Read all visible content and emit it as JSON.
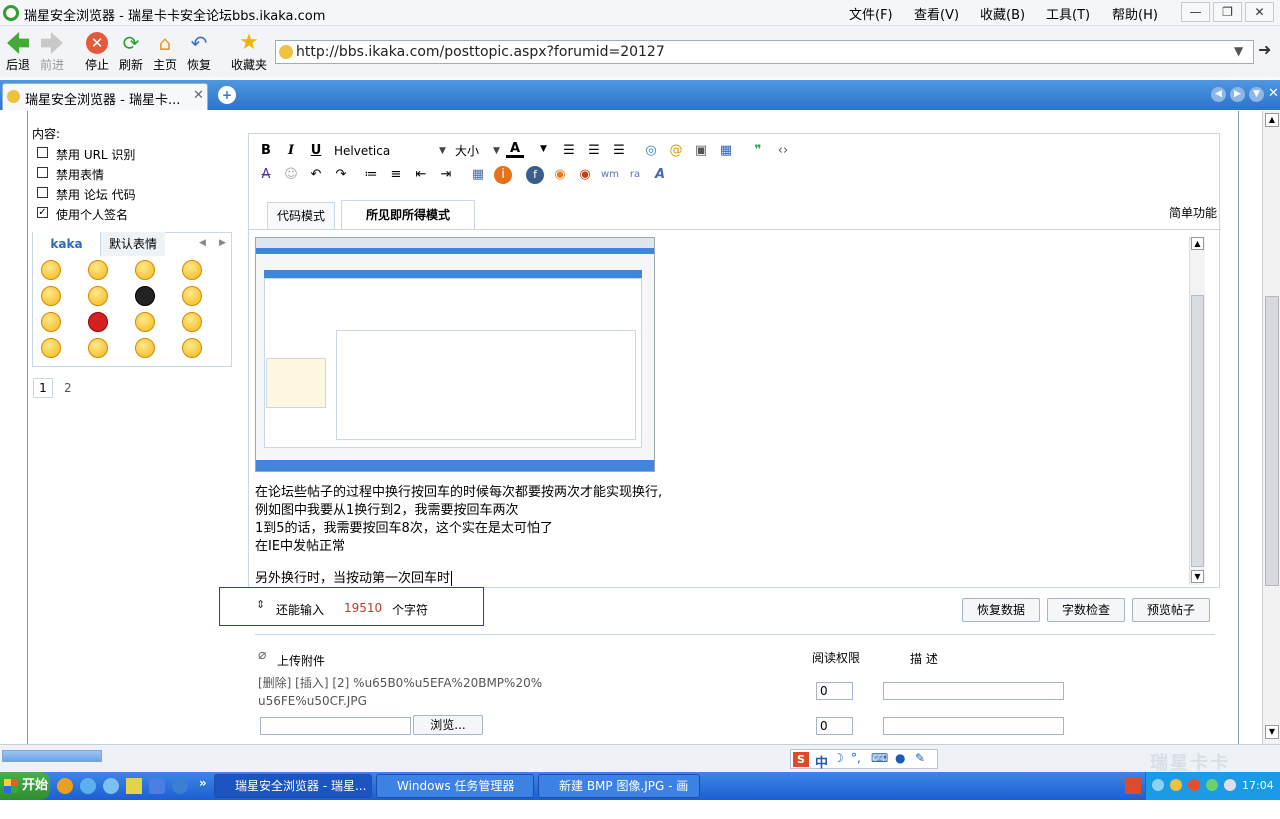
{
  "window": {
    "title": "瑞星安全浏览器 - 瑞星卡卡安全论坛bbs.ikaka.com"
  },
  "menu": {
    "file": "文件(F)",
    "view": "查看(V)",
    "favorites": "收藏(B)",
    "tools": "工具(T)",
    "help": "帮助(H)"
  },
  "toolbar": {
    "back": "后退",
    "forward": "前进",
    "stop": "停止",
    "refresh": "刷新",
    "home": "主页",
    "restore": "恢复",
    "favorites": "收藏夹"
  },
  "address": {
    "url": "http://bbs.ikaka.com/posttopic.aspx?forumid=20127"
  },
  "tabs": [
    {
      "label": "瑞星安全浏览器 - 瑞星卡..."
    }
  ],
  "left": {
    "content_label": "内容:",
    "options": [
      {
        "label": "禁用 URL 识别",
        "checked": false
      },
      {
        "label": "禁用表情",
        "checked": false
      },
      {
        "label": "禁用 论坛 代码",
        "checked": false
      },
      {
        "label": "使用个人签名",
        "checked": true
      }
    ],
    "emoticon_tabs": [
      "kaka",
      "默认表情"
    ],
    "pages": [
      "1",
      "2"
    ]
  },
  "editor": {
    "font_name": "Helvetica",
    "font_size": "大小",
    "mode_tabs": [
      "代码模式",
      "所见即所得模式"
    ],
    "simple_mode": "简单功能",
    "lines": [
      "在论坛些帖子的过程中换行按回车的时候每次都要按两次才能实现换行,",
      "例如图中我要从1换行到2，我需要按回车两次",
      "1到5的话，我需要按回车8次，这个实在是太可怕了",
      "在IE中发帖正常",
      "",
      "另外换行时，当按动第一次回车时"
    ]
  },
  "counter": {
    "prefix": "还能输入",
    "remaining": "19510",
    "suffix": "个字符"
  },
  "buttons": {
    "restore_data": "恢复数据",
    "check_count": "字数检查",
    "preview": "预览帖子"
  },
  "upload": {
    "title": "上传附件",
    "col_permission": "阅读权限",
    "col_description": "描 述",
    "file_line1": "[删除] [插入] [2] %u65B0%u5EFA%20BMP%20%",
    "file_line2": "u56FE%u50CF.JPG",
    "permission1": "0",
    "permission2": "0",
    "browse": "浏览..."
  },
  "taskbar": {
    "start": "开始",
    "tasks": [
      "瑞星安全浏览器 - 瑞星...",
      "Windows 任务管理器",
      "新建 BMP 图像.JPG - 画图"
    ],
    "ime": "中",
    "clock": "17:04",
    "watermark": "瑞星卡卡"
  }
}
